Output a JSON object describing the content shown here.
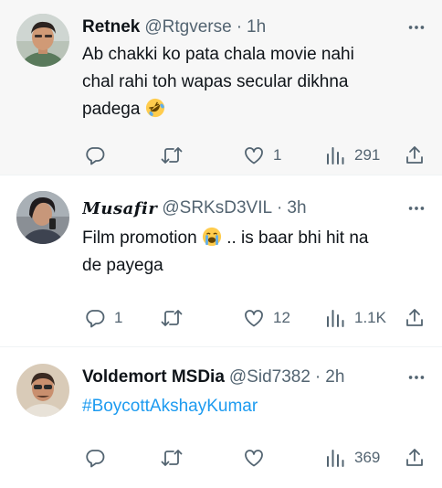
{
  "tweets": [
    {
      "name": "Retnek",
      "handle": "@Rtgverse",
      "dot": "·",
      "time": "1h",
      "lines": [
        "Ab chakki ko pata chala movie nahi",
        "chal rahi toh wapas secular dikhna",
        "padega"
      ],
      "emoji": "rolling-on-floor-laughing",
      "replies": "",
      "retweets": "",
      "likes": "1",
      "views": "291"
    },
    {
      "name": "𝑴𝒖𝒔𝒂𝒇𝒊𝒓",
      "handle": "@SRKsD3VIL",
      "dot": "·",
      "time": "3h",
      "line1_a": "Film promotion ",
      "line1_b": ".. is baar bhi hit na",
      "line2": "de payega",
      "emoji": "loudly-crying-face",
      "replies": "1",
      "retweets": "",
      "likes": "12",
      "views": "1.1K"
    },
    {
      "name": "Voldemort MSDia",
      "handle": "@Sid7382",
      "dot": "·",
      "time": "2h",
      "hashtag": "#BoycottAkshayKumar",
      "replies": "",
      "retweets": "",
      "likes": "",
      "views": "369"
    }
  ],
  "colors": {
    "text": "#0f1419",
    "secondary": "#536471",
    "link": "#1d9bf0",
    "hover_bg": "#f7f7f7",
    "divider": "#eff3f4"
  },
  "icons": [
    "reply-icon",
    "retweet-icon",
    "like-icon",
    "views-icon",
    "share-icon",
    "more-icon"
  ]
}
